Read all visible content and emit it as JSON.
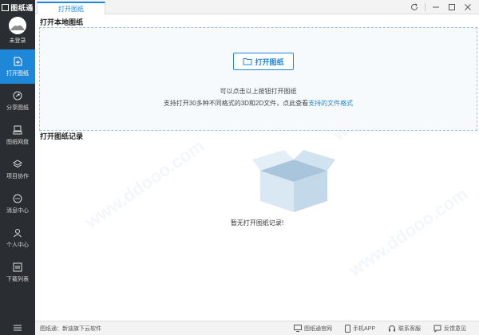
{
  "app": {
    "logo_text": "图纸通"
  },
  "user": {
    "login_label": "未登录"
  },
  "sidebar": {
    "items": [
      {
        "label": "打开图纸",
        "icon": "file-open-icon",
        "active": true
      },
      {
        "label": "分享图纸",
        "icon": "share-icon",
        "active": false
      },
      {
        "label": "图纸网盘",
        "icon": "cloud-drive-icon",
        "active": false
      },
      {
        "label": "项目协作",
        "icon": "layers-icon",
        "active": false
      },
      {
        "label": "消息中心",
        "icon": "message-icon",
        "active": false
      },
      {
        "label": "个人中心",
        "icon": "user-icon",
        "active": false
      },
      {
        "label": "下载列表",
        "icon": "download-list-icon",
        "active": false
      }
    ],
    "menu_icon": "hamburger-menu-icon"
  },
  "tabs": [
    {
      "label": "打开图纸",
      "active": true
    }
  ],
  "window_controls": {
    "refresh_icon": "refresh-icon",
    "minimize_icon": "minimize-icon",
    "maximize_icon": "maximize-icon",
    "close_icon": "close-icon"
  },
  "main": {
    "local_title": "打开本地图纸",
    "open_button_label": "打开图纸",
    "hint_line1": "可以点击以上按钮打开图纸",
    "hint_line2_prefix": "支持打开30多种不同格式的3D和2D文件，点此查看",
    "hint_line2_link": "支持的文件格式",
    "records_title": "打开图纸记录",
    "empty_text": "暂无打开图纸记录!"
  },
  "status_bar": {
    "left_text": "图纸通：新迪旗下云软件",
    "links": [
      {
        "label": "图纸通官网",
        "icon": "monitor-icon"
      },
      {
        "label": "手机APP",
        "icon": "phone-icon"
      },
      {
        "label": "联系客服",
        "icon": "headset-icon"
      },
      {
        "label": "反馈意见",
        "icon": "feedback-icon"
      }
    ]
  },
  "colors": {
    "accent": "#1f87d8",
    "sidebar_bg": "#2a2d31",
    "dropzone_border": "#9ac4e9"
  }
}
